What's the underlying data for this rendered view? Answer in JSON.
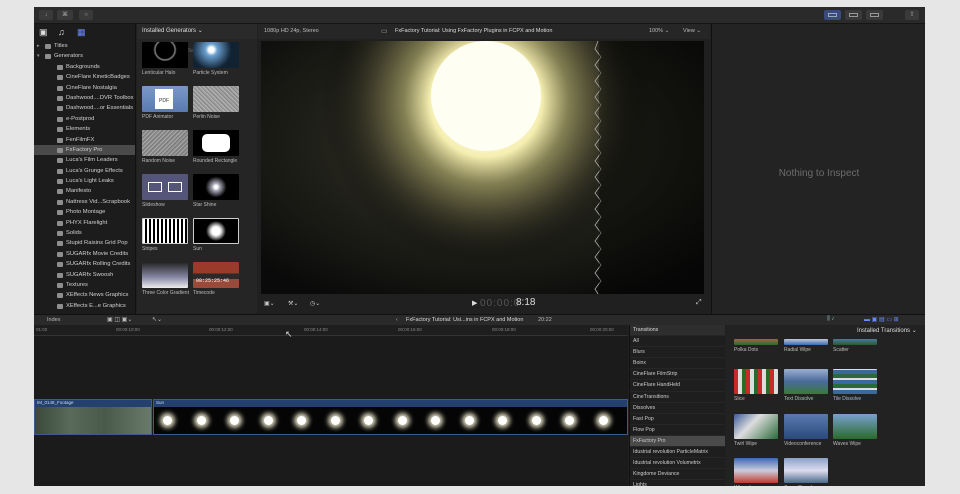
{
  "topbar": {
    "btn1": "↓",
    "btn2": "⌘",
    "btn3": "○",
    "btn4": "⇧"
  },
  "library": {
    "items": [
      {
        "label": "Titles",
        "level": 0,
        "arrow": "▸"
      },
      {
        "label": "Generators",
        "level": 0,
        "arrow": "▾"
      },
      {
        "label": "Backgrounds",
        "level": 1
      },
      {
        "label": "CineFlare KineticBadges",
        "level": 1
      },
      {
        "label": "CineFlare Nostalgia",
        "level": 1
      },
      {
        "label": "Dashwood....DVR Toolbox",
        "level": 1
      },
      {
        "label": "Dashwood....or Essentials",
        "level": 1
      },
      {
        "label": "e-Postprod",
        "level": 1
      },
      {
        "label": "Elements",
        "level": 1
      },
      {
        "label": "FenFilmFX",
        "level": 1
      },
      {
        "label": "FxFactory Pro",
        "level": 1,
        "selected": true
      },
      {
        "label": "Luca's Film Leaders",
        "level": 1
      },
      {
        "label": "Luca's Grunge Effects",
        "level": 1
      },
      {
        "label": "Luca's Light Leaks",
        "level": 1
      },
      {
        "label": "Manifesto",
        "level": 1
      },
      {
        "label": "Nattress Vid...Scrapbook",
        "level": 1
      },
      {
        "label": "Photo Montage",
        "level": 1
      },
      {
        "label": "PHYX Flarelight",
        "level": 1
      },
      {
        "label": "Solids",
        "level": 1
      },
      {
        "label": "Stupid Raisins Grid Pop",
        "level": 1
      },
      {
        "label": "SUGARfx Movie Credits",
        "level": 1
      },
      {
        "label": "SUGARfx Rolling Credits",
        "level": 1
      },
      {
        "label": "SUGARfx Swoosh",
        "level": 1
      },
      {
        "label": "Textures",
        "level": 1
      },
      {
        "label": "XEffects News Graphics",
        "level": 1
      },
      {
        "label": "XEffects E...e Graphics",
        "level": 1
      }
    ]
  },
  "browser": {
    "header": "Installed Generators",
    "search_placeholder": "Search",
    "thumbs": [
      {
        "label": "Lenticular Halo",
        "style": "halo"
      },
      {
        "label": "Particle System",
        "style": "particle"
      },
      {
        "label": "PDF Animator",
        "style": "pdf",
        "badge": "PDF"
      },
      {
        "label": "Perlin Noise",
        "style": "noise"
      },
      {
        "label": "Random Noise",
        "style": "rnoise"
      },
      {
        "label": "Rounded Rectangle",
        "style": "rrect"
      },
      {
        "label": "Slideshow",
        "style": "slide"
      },
      {
        "label": "Star Shine",
        "style": "star"
      },
      {
        "label": "Stripes",
        "style": "stripes"
      },
      {
        "label": "Sun",
        "style": "sun"
      },
      {
        "label": "Three Color Gradient",
        "style": "grad"
      },
      {
        "label": "Timecode",
        "style": "timecode",
        "badge": "00:25:25:46"
      }
    ]
  },
  "viewer": {
    "format": "1080p HD 24p, Stereo",
    "title": "FxFactory Tutorial: Using FxFactory Plugins in FCPX and Motion",
    "zoom": "100%",
    "view": "View",
    "timecode": "8:18",
    "timecode_prefix": "00:00:0"
  },
  "inspector": {
    "empty_text": "Nothing to Inspect"
  },
  "timeline": {
    "index_label": "Index",
    "project_title": "FxFactory Tutorial: Usi...ins in FCPX and Motion",
    "duration": "20:22",
    "ruler": [
      "01:00",
      "00:00:10:00",
      "00:00:12:00",
      "00:00:14:00",
      "00:00:16:00",
      "00:00:18:00",
      "00:00:20:00"
    ],
    "clip1_label": "IM_0148_Footage",
    "clip2_label": "Sun"
  },
  "transitions": {
    "header": "Transitions",
    "grid_header": "Installed Transitions",
    "categories": [
      {
        "label": "All"
      },
      {
        "label": "Blurs"
      },
      {
        "label": "Boinx"
      },
      {
        "label": "CineFlare FilmStrip"
      },
      {
        "label": "CineFlare HandHeld"
      },
      {
        "label": "CineTransitions"
      },
      {
        "label": "Dissolves"
      },
      {
        "label": "Fast Pop"
      },
      {
        "label": "Flow Pop"
      },
      {
        "label": "FxFactory Pro",
        "selected": true
      },
      {
        "label": "Idustrial revolution ParticleMatrix"
      },
      {
        "label": "Idustrial revolution Volumetrix"
      },
      {
        "label": "Kingdome Deviance"
      },
      {
        "label": "Lights"
      }
    ],
    "items": [
      {
        "label": "Polka Dots"
      },
      {
        "label": "Radial Wipe"
      },
      {
        "label": "Scatter"
      },
      {
        "label": "Slice"
      },
      {
        "label": "Text Dissolve"
      },
      {
        "label": "Tile Dissolve"
      },
      {
        "label": "Twirl Wipe"
      },
      {
        "label": "Videoconference"
      },
      {
        "label": "Waves Wipe"
      },
      {
        "label": "Whoosh"
      },
      {
        "label": "Zoom Dissolve"
      }
    ]
  }
}
